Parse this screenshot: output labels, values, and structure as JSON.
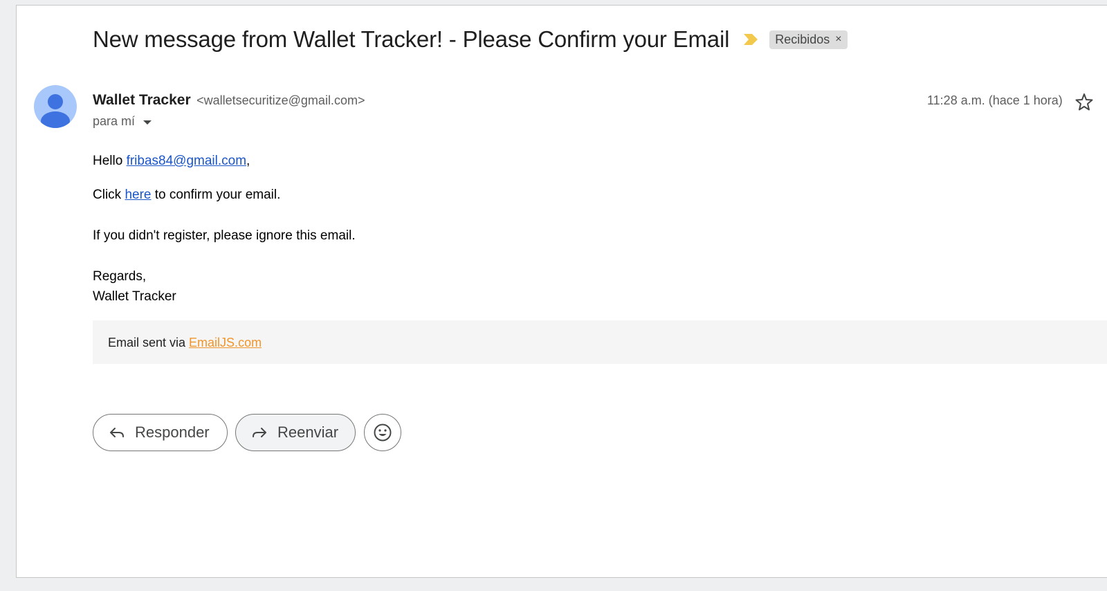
{
  "message": {
    "subject": "New message from Wallet Tracker! - Please Confirm your Email",
    "label": "Recibidos",
    "label_close": "×",
    "sender_name": "Wallet Tracker",
    "sender_email": "<walletsecuritize@gmail.com>",
    "to_line": "para mí",
    "timestamp": "11:28 a.m. (hace 1 hora)"
  },
  "body": {
    "greeting_prefix": "Hello ",
    "greeting_email": "fribas84@gmail.com",
    "greeting_suffix": ",",
    "click_prefix": "Click ",
    "click_link": "here",
    "click_suffix": " to confirm your email.",
    "ignore_line": "If you didn't register, please ignore this email.",
    "regards": "Regards,",
    "signature": "Wallet Tracker"
  },
  "footer": {
    "prefix": "Email sent via ",
    "link": "EmailJS.com"
  },
  "actions": {
    "reply_label": "Responder",
    "forward_label": "Reenviar"
  },
  "colors": {
    "link": "#1a55c8",
    "footer_link": "#f0952a",
    "important_marker": "#f2c94c",
    "avatar_bg": "#a8c7fa",
    "avatar_fg": "#3d72e0"
  },
  "icons": {
    "important": "importance-marker-icon",
    "label_close": "close-icon",
    "avatar": "person-icon",
    "recipients": "chevron-down-icon",
    "star": "star-icon",
    "reply": "reply-arrow-icon",
    "forward": "forward-arrow-icon",
    "emoji": "emoji-icon"
  }
}
